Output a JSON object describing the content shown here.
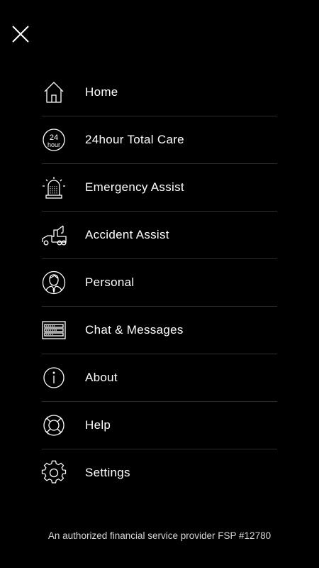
{
  "close": {
    "icon": "close-icon"
  },
  "menu": {
    "items": [
      {
        "label": "Home",
        "icon": "home-icon"
      },
      {
        "label": "24hour Total Care",
        "icon": "24hour-icon"
      },
      {
        "label": "Emergency Assist",
        "icon": "siren-icon"
      },
      {
        "label": "Accident Assist",
        "icon": "tow-truck-icon"
      },
      {
        "label": "Personal",
        "icon": "person-icon"
      },
      {
        "label": "Chat & Messages",
        "icon": "chat-icon"
      },
      {
        "label": "About",
        "icon": "info-icon"
      },
      {
        "label": "Help",
        "icon": "lifebuoy-icon"
      },
      {
        "label": "Settings",
        "icon": "gear-icon"
      }
    ],
    "icon_24_top": "24",
    "icon_24_bottom": "hour"
  },
  "footer": {
    "text": "An authorized financial service provider FSP #12780"
  },
  "colors": {
    "background": "#000000",
    "text": "#ffffff",
    "divider": "#2c2c2c"
  }
}
